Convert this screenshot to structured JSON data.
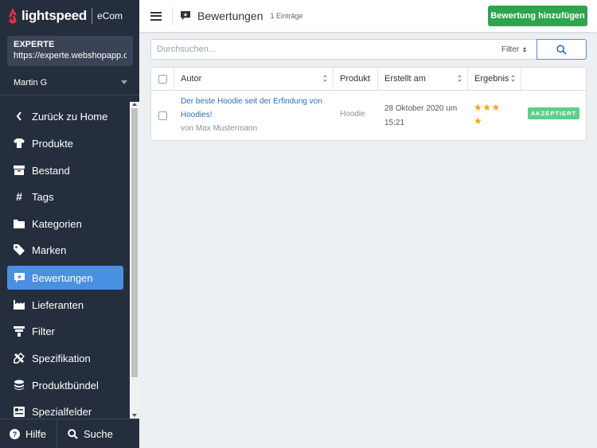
{
  "brand": {
    "name": "lightspeed",
    "product": "eCom",
    "colors": {
      "sidebar": "#252e3d",
      "accent": "#4a90e2",
      "logo": "#e4343f"
    }
  },
  "shop": {
    "name": "EXPERTE",
    "url": "https://experte.webshopapp.c..."
  },
  "user": {
    "name": "Martin G"
  },
  "nav": {
    "items": [
      {
        "label": "Zurück zu Home",
        "icon": "chevron-left-icon"
      },
      {
        "label": "Produkte",
        "icon": "tshirt-icon"
      },
      {
        "label": "Bestand",
        "icon": "box-icon"
      },
      {
        "label": "Tags",
        "icon": "hashtag-icon"
      },
      {
        "label": "Kategorien",
        "icon": "folder-icon"
      },
      {
        "label": "Marken",
        "icon": "tag-icon"
      },
      {
        "label": "Bewertungen",
        "icon": "review-icon",
        "active": true
      },
      {
        "label": "Lieferanten",
        "icon": "factory-icon"
      },
      {
        "label": "Filter",
        "icon": "filter-icon"
      },
      {
        "label": "Spezifikation",
        "icon": "tools-icon"
      },
      {
        "label": "Produktbündel",
        "icon": "layers-icon"
      },
      {
        "label": "Spezialfelder",
        "icon": "fields-icon"
      }
    ]
  },
  "footer": {
    "help_label": "Hilfe",
    "search_label": "Suche"
  },
  "header": {
    "title": "Bewertungen",
    "count": "1 Einträge",
    "add_button": "Bewertung hinzufügen"
  },
  "search": {
    "placeholder": "Durchsuchen...",
    "value": "",
    "filter_label": "Filter"
  },
  "table": {
    "columns": {
      "author": "Autor",
      "product": "Produkt",
      "created": "Erstellt am",
      "result": "Ergebnis"
    },
    "rows": [
      {
        "title_line1": "Der beste Hoodie seit der Erfindung von",
        "title_line2": "Hoodies!",
        "author": "von Max Mustermann",
        "product": "Hoodie",
        "date_line1": "28 Oktober 2020 um",
        "date_line2": "15:21",
        "stars_line1": "★★★",
        "stars_line2": "★",
        "rating": 4,
        "status": "AKZEPTIERT"
      }
    ]
  }
}
